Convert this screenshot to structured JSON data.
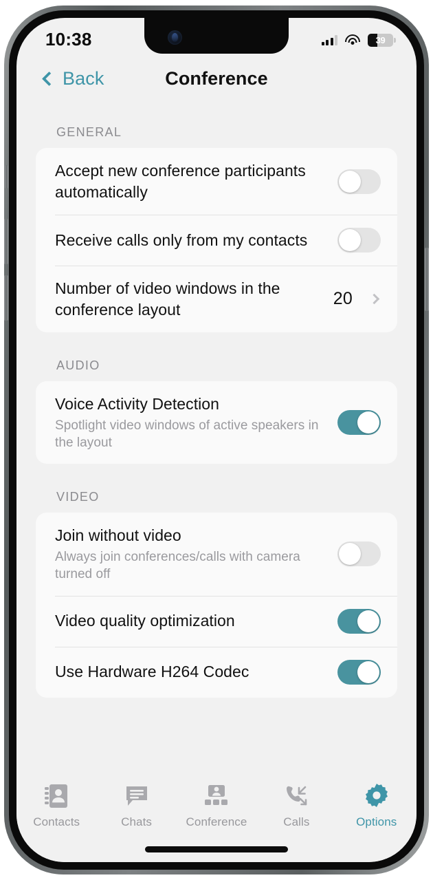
{
  "status_bar": {
    "time": "10:38",
    "battery_percent": "39",
    "battery_level": 39,
    "cellular_icon": "cellular-bars-icon",
    "wifi_icon": "wifi-icon",
    "battery_icon": "battery-icon"
  },
  "nav": {
    "back_label": "Back",
    "back_icon": "chevron-left-icon",
    "title": "Conference"
  },
  "theme": {
    "accent": "#3f95a8",
    "toggle_on": "#49939f",
    "toggle_off": "#e4e4e4",
    "page_background": "#f1f1f1",
    "card_background": "#fafafa",
    "text_primary": "#111111",
    "text_secondary": "#9a9a9e",
    "section_header": "#8b8b8f"
  },
  "sections": [
    {
      "header": "GENERAL",
      "rows": [
        {
          "name": "accept-new-participants",
          "title": "Accept new conference participants automatically",
          "subtitle": "",
          "control": "toggle",
          "value": "off"
        },
        {
          "name": "receive-calls-my-contacts",
          "title": "Receive calls only from my contacts",
          "subtitle": "",
          "control": "toggle",
          "value": "off"
        },
        {
          "name": "number-of-video-windows",
          "title": "Number of video windows in the conference layout",
          "subtitle": "",
          "control": "disclosure",
          "value": "20",
          "chevron_icon": "chevron-right-icon"
        }
      ]
    },
    {
      "header": "AUDIO",
      "rows": [
        {
          "name": "voice-activity-detection",
          "title": "Voice Activity Detection",
          "subtitle": "Spotlight video windows of active speakers in the layout",
          "control": "toggle",
          "value": "on"
        }
      ]
    },
    {
      "header": "VIDEO",
      "rows": [
        {
          "name": "join-without-video",
          "title": "Join without video",
          "subtitle": "Always join conferences/calls with camera turned off",
          "control": "toggle",
          "value": "off"
        },
        {
          "name": "video-quality-optimization",
          "title": "Video quality optimization",
          "subtitle": "",
          "control": "toggle",
          "value": "on"
        },
        {
          "name": "use-hardware-h264-codec",
          "title": "Use Hardware H264 Codec",
          "subtitle": "",
          "control": "toggle",
          "value": "on"
        }
      ]
    }
  ],
  "tabs": [
    {
      "name": "contacts",
      "label": "Contacts",
      "icon": "contacts-book-icon",
      "active": false
    },
    {
      "name": "chats",
      "label": "Chats",
      "icon": "chat-bubble-icon",
      "active": false
    },
    {
      "name": "conference",
      "label": "Conference",
      "icon": "conference-grid-icon",
      "active": false
    },
    {
      "name": "calls",
      "label": "Calls",
      "icon": "phone-arrows-icon",
      "active": false
    },
    {
      "name": "options",
      "label": "Options",
      "icon": "gear-icon",
      "active": true
    }
  ]
}
